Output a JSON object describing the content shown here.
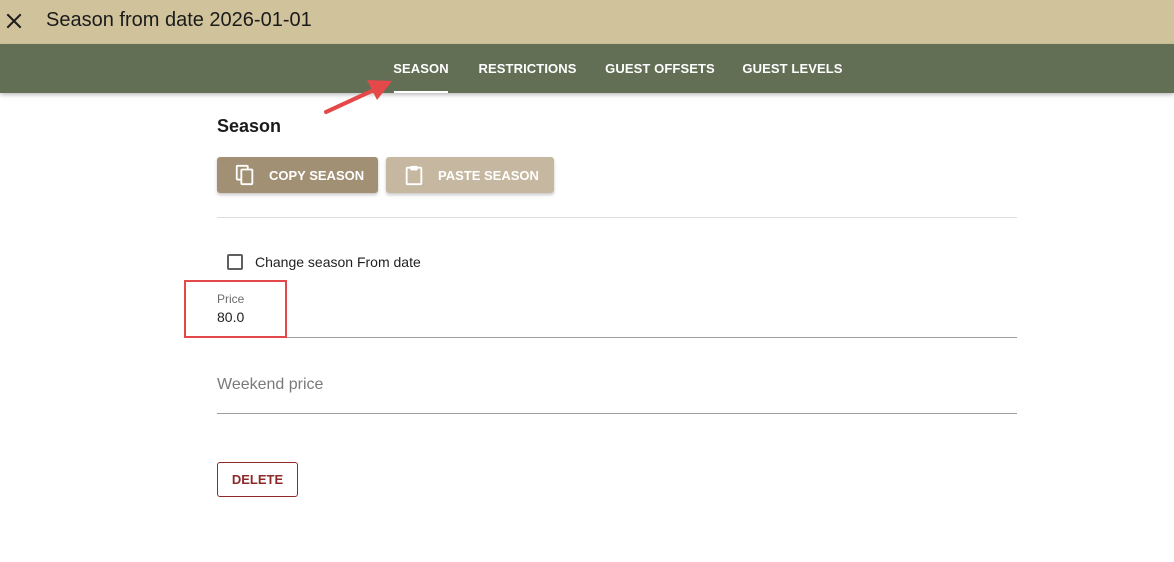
{
  "header": {
    "title": "Season from date 2026-01-01",
    "close_icon": "close-icon",
    "background": "#d0c29b"
  },
  "tabs": [
    {
      "label": "SEASON",
      "active": true
    },
    {
      "label": "RESTRICTIONS",
      "active": false
    },
    {
      "label": "GUEST OFFSETS",
      "active": false
    },
    {
      "label": "GUEST LEVELS",
      "active": false
    }
  ],
  "tabbar_color": "#626f55",
  "main": {
    "section_title": "Season",
    "copy_button": {
      "label": "COPY SEASON",
      "icon": "copy-icon",
      "color": "#a19073"
    },
    "paste_button": {
      "label": "PASTE SEASON",
      "icon": "clipboard-icon",
      "color": "#c6b8a0"
    },
    "change_from_date": {
      "label": "Change season From date",
      "checked": false
    },
    "price": {
      "label": "Price",
      "value": "80.0"
    },
    "weekend_price": {
      "placeholder": "Weekend price",
      "value": ""
    },
    "delete_button": {
      "label": "DELETE",
      "color": "#8e2a2a"
    }
  },
  "annotations": {
    "arrow_color": "#e54848",
    "highlight_color": "#e54848"
  }
}
